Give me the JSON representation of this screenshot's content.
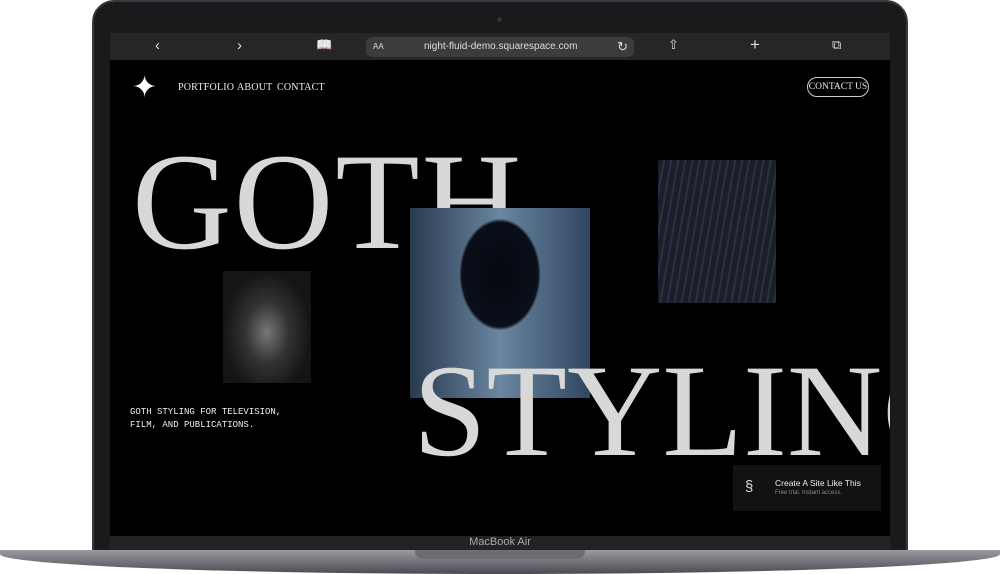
{
  "browser": {
    "back_icon": "‹",
    "forward_icon": "›",
    "bookmarks_icon": "book-icon",
    "text_size": "AA",
    "url": "night-fluid-demo.squarespace.com",
    "reload_icon": "↻",
    "share_icon": "⇧",
    "new_tab": "+",
    "tabs_icon": "⧉"
  },
  "site": {
    "logo": "✦",
    "nav": [
      "PORTFOLIO",
      "ABOUT",
      "CONTACT"
    ],
    "cta": "CONTACT US",
    "title_top": "GOTH",
    "title_bottom": "STYLING",
    "tagline": "GOTH STYLING FOR TELEVISION, FILM, AND PUBLICATIONS."
  },
  "badge": {
    "title": "Create A Site Like This",
    "subtitle": "Free trial. Instant access."
  },
  "device": {
    "model": "MacBook Air"
  }
}
